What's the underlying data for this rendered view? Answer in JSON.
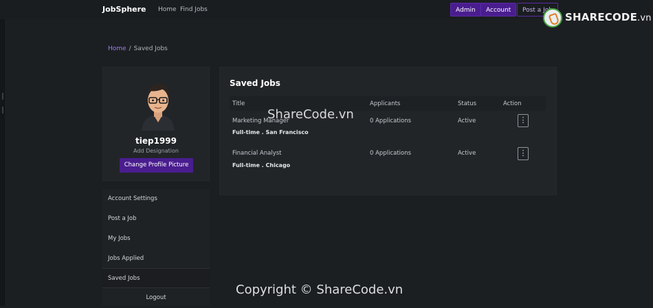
{
  "nav": {
    "brand": "JobSphere",
    "links": [
      "Home",
      "Find Jobs"
    ],
    "buttons": [
      "Admin",
      "Account",
      "Post a Job"
    ]
  },
  "watermarks": {
    "logo_share": "SHARE",
    "logo_code": "CODE",
    "logo_vn": ".vn",
    "center": "ShareCode.vn",
    "bottom": "Copyright © ShareCode.vn"
  },
  "breadcrumb": {
    "home": "Home",
    "separator": "/",
    "current": "Saved Jobs"
  },
  "profile": {
    "username": "tiep1999",
    "designation": "Add Designation",
    "change_picture_label": "Change Profile Picture"
  },
  "menu": {
    "items": [
      "Account Settings",
      "Post a Job",
      "My Jobs",
      "Jobs Applied",
      "Saved Jobs",
      "Logout"
    ]
  },
  "saved_jobs": {
    "title": "Saved Jobs",
    "columns": [
      "Title",
      "Applicants",
      "Status",
      "Action"
    ],
    "rows": [
      {
        "title": "Marketing Manager",
        "meta": "Full-time . San Francisco",
        "applicants": "0 Applications",
        "status": "Active",
        "action_icon": "kebab-menu-icon"
      },
      {
        "title": "Financial Analyst",
        "meta": "Full-time . Chicago",
        "applicants": "0 Applications",
        "status": "Active",
        "action_icon": "kebab-menu-icon"
      }
    ]
  },
  "colors": {
    "accent": "#4a1d8f",
    "link": "#9b7ff0",
    "background": "#1c1f22",
    "card": "#222528"
  }
}
